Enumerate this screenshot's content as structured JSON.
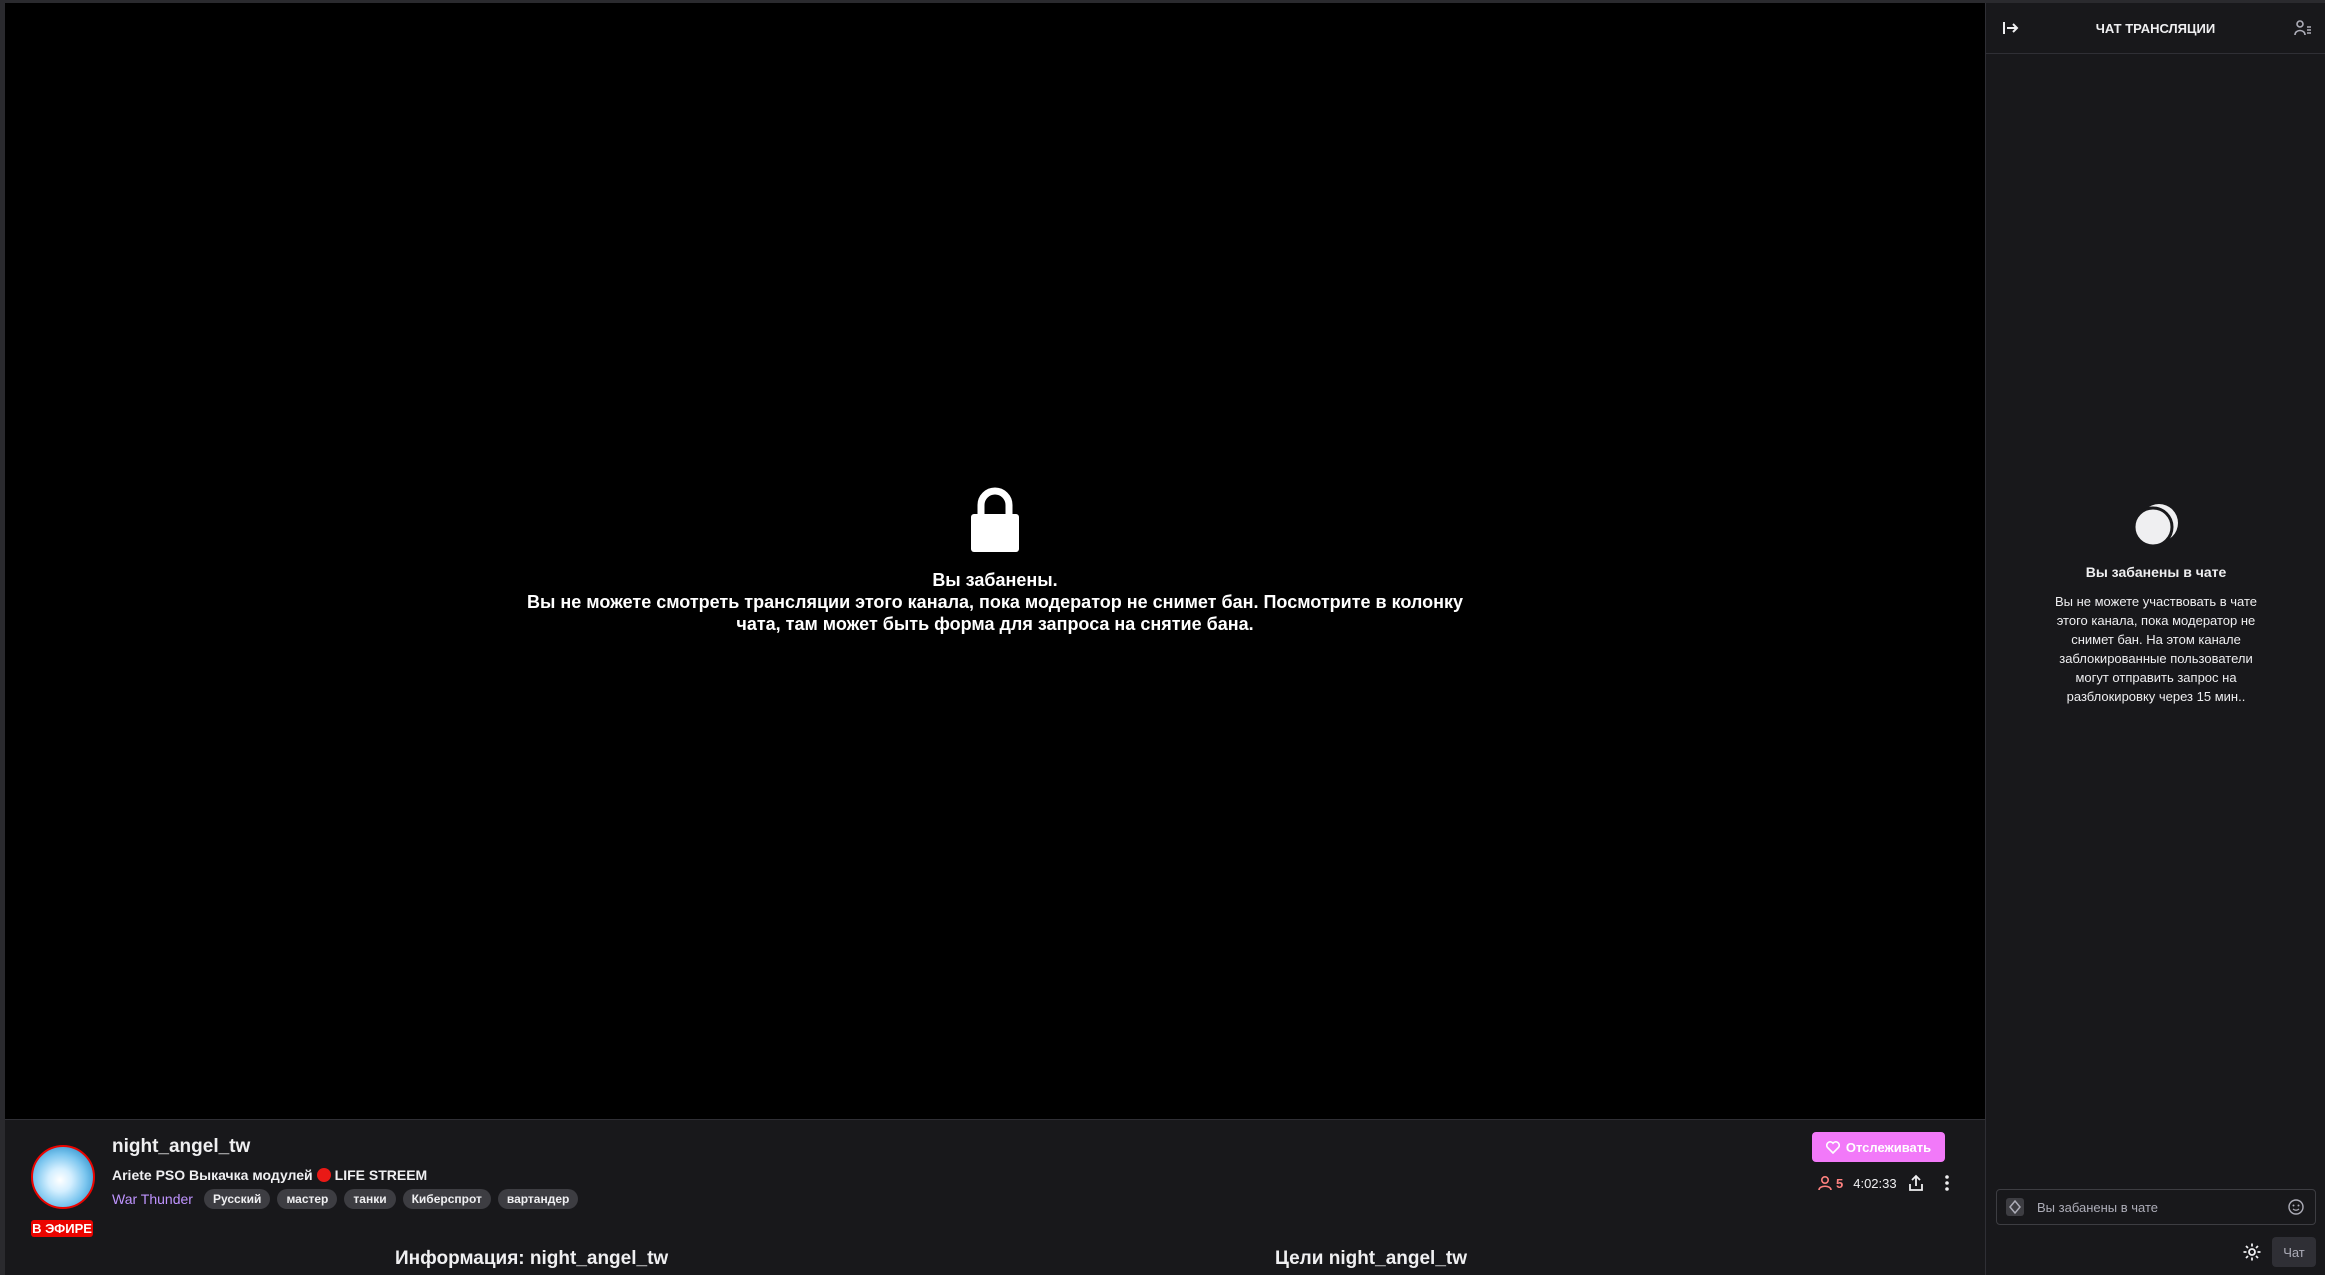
{
  "player": {
    "ban_title": "Вы забанены.",
    "ban_message": "Вы не можете смотреть трансляции этого канала, пока модератор не снимет бан. Посмотрите в колонку чата, там может быть форма для запроса на снятие бана."
  },
  "channel": {
    "name": "night_angel_tw",
    "live_badge": "В ЭФИРЕ",
    "title_prefix": "Ariete PSO Выкачка модулей",
    "title_suffix": "LIFE STREEM",
    "game": "War Thunder",
    "tags": [
      "Русский",
      "мастер",
      "танки",
      "Киберспрот",
      "вартандер"
    ],
    "follow_label": "Отслеживать",
    "viewers": "5",
    "uptime": "4:02:33"
  },
  "sections": {
    "info": "Информация: night_angel_tw",
    "goals": "Цели night_angel_tw"
  },
  "chat": {
    "header": "ЧАТ ТРАНСЛЯЦИИ",
    "banned_title": "Вы забанены в чате",
    "banned_text": "Вы не можете участвовать в чате этого канала, пока модератор не снимет бан. На этом канале заблокированные пользователи могут отправить запрос на разблокировку через 15 мин..",
    "input_placeholder": "Вы забанены в чате",
    "chat_button": "Чат"
  },
  "colors": {
    "accent": "#bf94ff",
    "follow": "#f279f9",
    "live": "#eb0400"
  }
}
